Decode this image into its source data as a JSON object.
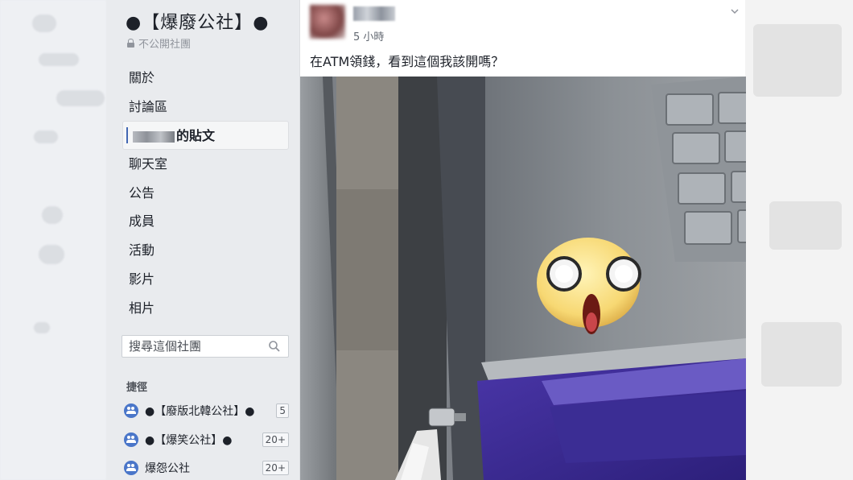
{
  "group": {
    "title": "●【爆廢公社】●",
    "privacy": "不公開社團"
  },
  "nav": [
    {
      "label": "關於"
    },
    {
      "label": "討論區"
    },
    {
      "label": "的貼文",
      "active": true
    },
    {
      "label": "聊天室"
    },
    {
      "label": "公告"
    },
    {
      "label": "成員"
    },
    {
      "label": "活動"
    },
    {
      "label": "影片"
    },
    {
      "label": "相片"
    }
  ],
  "search": {
    "placeholder": "搜尋這個社團"
  },
  "shortcuts": {
    "heading": "捷徑",
    "items": [
      {
        "label": "●【廢版北韓公社】●",
        "count": "5"
      },
      {
        "label": "●【爆笑公社】●",
        "count": "20+"
      },
      {
        "label": "爆怨公社",
        "count": "20+"
      }
    ]
  },
  "post": {
    "time": "5 小時",
    "text": "在ATM領錢，看到這個我該開嗎？"
  },
  "colors": {
    "accent": "#4267b2",
    "shortcut_icon": "#4a76c9",
    "atm_purple": "#3a2c8f"
  },
  "icons": {
    "privacy": "lock-icon",
    "search": "search-icon",
    "shortcut": "group-icon",
    "menu": "chevron-down-icon"
  }
}
